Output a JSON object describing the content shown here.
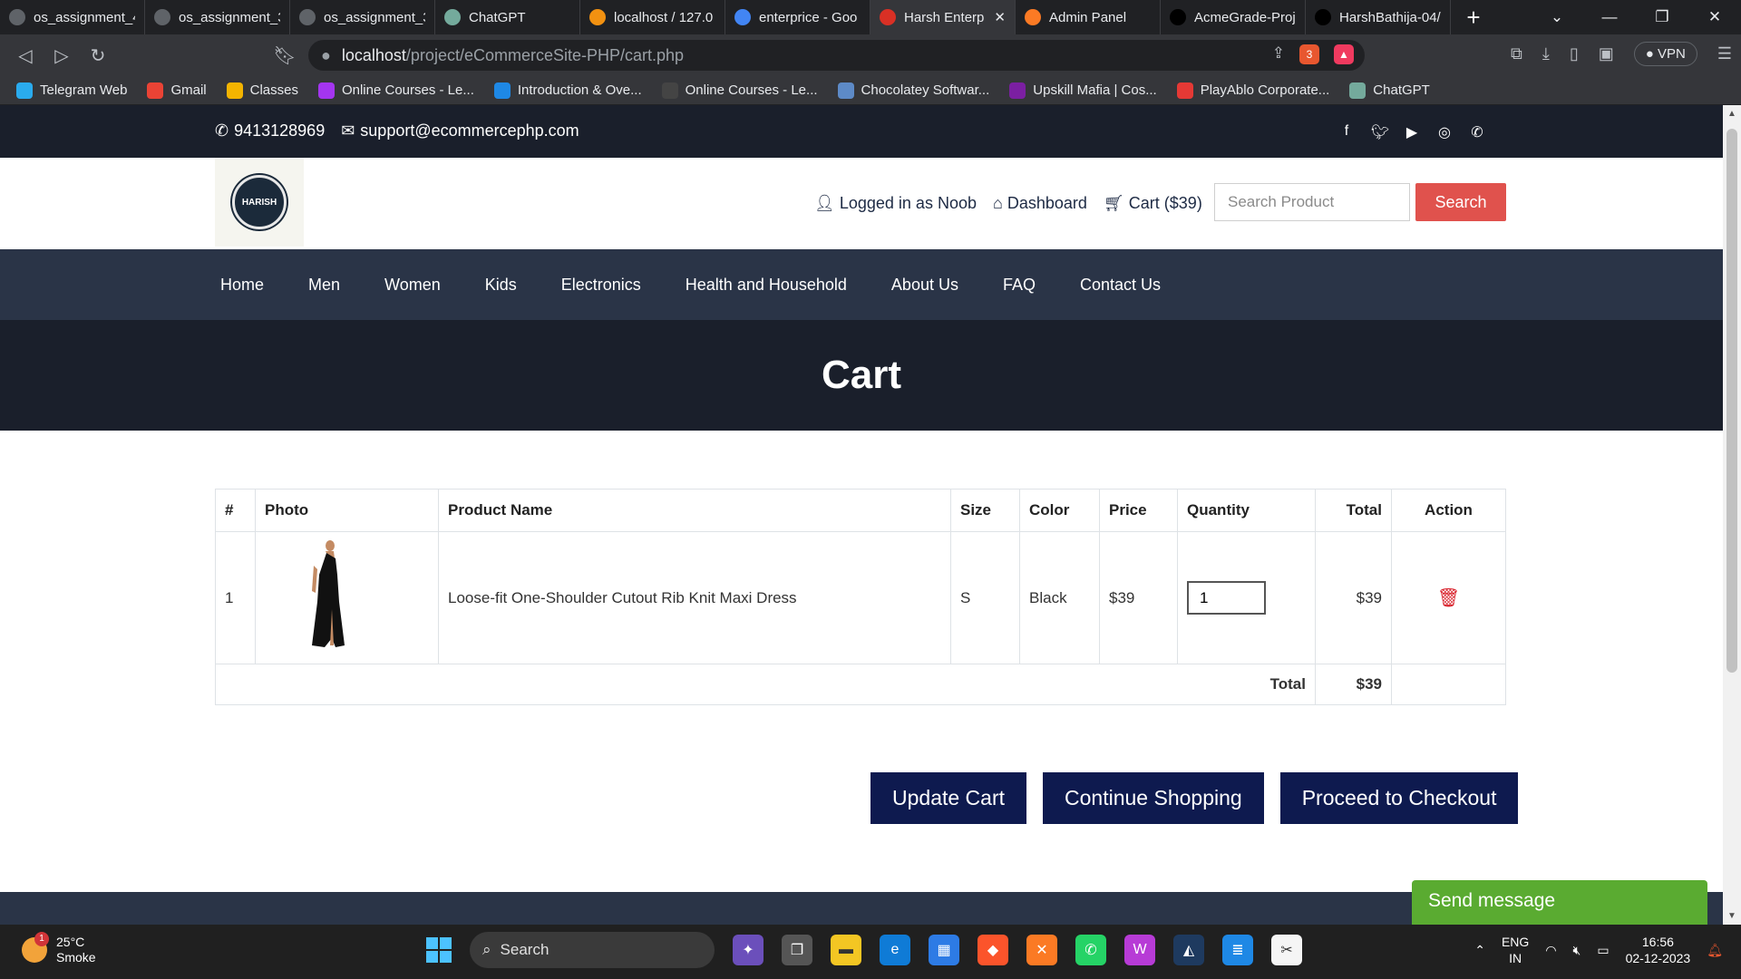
{
  "browser": {
    "tabs": [
      {
        "title": "os_assignment_4",
        "icon": "generic-globe-icon",
        "color": "#5f6368"
      },
      {
        "title": "os_assignment_3",
        "icon": "generic-globe-icon",
        "color": "#5f6368"
      },
      {
        "title": "os_assignment_3",
        "icon": "generic-globe-icon",
        "color": "#5f6368"
      },
      {
        "title": "ChatGPT",
        "icon": "chatgpt-icon",
        "color": "#74aa9c"
      },
      {
        "title": "localhost / 127.0",
        "icon": "phpmyadmin-icon",
        "color": "#f29111"
      },
      {
        "title": "enterprice - Goo",
        "icon": "google-icon",
        "color": "#4285f4"
      },
      {
        "title": "Harsh Enterp",
        "icon": "cart-icon",
        "color": "#d93025"
      },
      {
        "title": "Admin Panel",
        "icon": "xampp-icon",
        "color": "#fb7a24"
      },
      {
        "title": "AcmeGrade-Proj",
        "icon": "github-icon",
        "color": "#000000"
      },
      {
        "title": "HarshBathija-04/",
        "icon": "github-icon",
        "color": "#000000"
      }
    ],
    "active_tab_index": 6,
    "url_host": "localhost",
    "url_path": "/project/eCommerceSite-PHP/cart.php",
    "brave_badge": "3",
    "vpn_label": "VPN",
    "bookmarks": [
      {
        "label": "Telegram Web",
        "color": "#2aabee"
      },
      {
        "label": "Gmail",
        "color": "#ea4335"
      },
      {
        "label": "Classes",
        "color": "#f4b400"
      },
      {
        "label": "Online Courses - Le...",
        "color": "#a435f0"
      },
      {
        "label": "Introduction & Ove...",
        "color": "#1e88e5"
      },
      {
        "label": "Online Courses - Le...",
        "color": "#444444"
      },
      {
        "label": "Chocolatey Softwar...",
        "color": "#5d8ac7"
      },
      {
        "label": "Upskill Mafia | Cos...",
        "color": "#7b1fa2"
      },
      {
        "label": "PlayAblo Corporate...",
        "color": "#e53935"
      },
      {
        "label": "ChatGPT",
        "color": "#74aa9c"
      }
    ]
  },
  "topbar": {
    "phone": "9413128969",
    "email": "support@ecommercephp.com",
    "socials": [
      "facebook-icon",
      "twitter-icon",
      "youtube-icon",
      "instagram-icon",
      "whatsapp-icon"
    ]
  },
  "header": {
    "logo_text": "HARISH",
    "logged_in": "Logged in as Noob",
    "dashboard": "Dashboard",
    "cart": "Cart ($39)",
    "search_placeholder": "Search Product",
    "search_button": "Search"
  },
  "nav": [
    "Home",
    "Men",
    "Women",
    "Kids",
    "Electronics",
    "Health and Household",
    "About Us",
    "FAQ",
    "Contact Us"
  ],
  "page_title": "Cart",
  "cart": {
    "columns": [
      "#",
      "Photo",
      "Product Name",
      "Size",
      "Color",
      "Price",
      "Quantity",
      "Total",
      "Action"
    ],
    "rows": [
      {
        "num": "1",
        "name": "Loose-fit One-Shoulder Cutout Rib Knit Maxi Dress",
        "size": "S",
        "color": "Black",
        "price": "$39",
        "quantity": "1",
        "total": "$39"
      }
    ],
    "total_label": "Total",
    "total_value": "$39"
  },
  "actions": {
    "update": "Update Cart",
    "continue": "Continue Shopping",
    "checkout": "Proceed to Checkout"
  },
  "chat_widget": "Send message",
  "taskbar": {
    "weather_temp": "25°C",
    "weather_desc": "Smoke",
    "weather_badge": "1",
    "search_label": "Search",
    "lang_top": "ENG",
    "lang_bottom": "IN",
    "time": "16:56",
    "date": "02-12-2023"
  }
}
